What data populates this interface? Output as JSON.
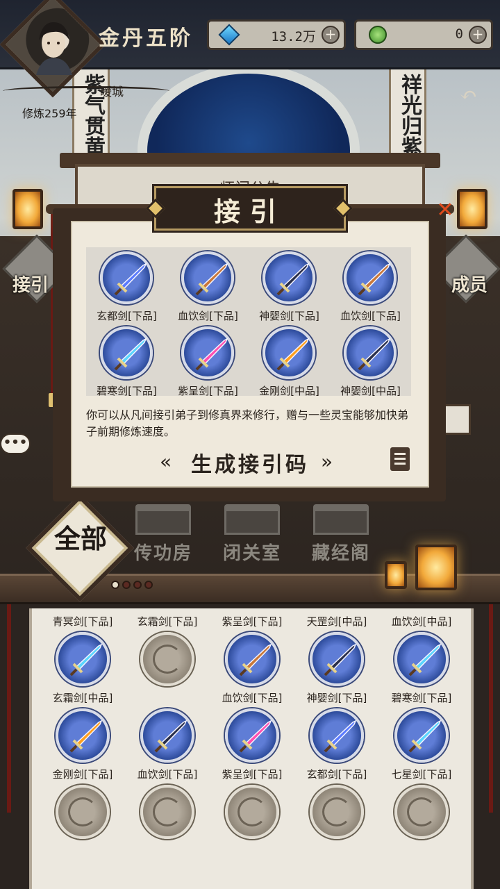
{
  "header": {
    "sect_name": "金丹五阶",
    "resources": [
      {
        "icon": "spirit-stone-icon",
        "value": "13.2万",
        "plus": "+"
      },
      {
        "icon": "jade-icon",
        "value": "0",
        "plus": "+"
      }
    ],
    "city": "暖城",
    "years": "修炼259年"
  },
  "scene": {
    "couplet_left": "紫气贯黄",
    "couplet_right": "祥光归紫",
    "board_title": "师门公告",
    "side_left": "接引",
    "side_right": "成员",
    "chat": "•••",
    "buildings": [
      "传功房",
      "闭关室",
      "藏经阁"
    ],
    "all_tab": "全部"
  },
  "modal": {
    "title": "接引",
    "close": "✕",
    "rewards": [
      {
        "label": "玄都剑[下品]",
        "color": "#5b7bff"
      },
      {
        "label": "血饮剑[下品]",
        "color": "#c9783a"
      },
      {
        "label": "神婴剑[下品]",
        "color": "#2a2f4a"
      },
      {
        "label": "血饮剑[下品]",
        "color": "#c9783a"
      },
      {
        "label": "碧寒剑[下品]",
        "color": "#5ad6ff"
      },
      {
        "label": "紫呈剑[下品]",
        "color": "#ff4fb0"
      },
      {
        "label": "金刚剑[中品]",
        "color": "#ffa01e"
      },
      {
        "label": "神婴剑[中品]",
        "color": "#2a2f4a"
      }
    ],
    "description": "你可以从凡间接引弟子到修真界来修行，赠与一些灵宝能够加快弟子前期修炼速度。",
    "generate_button": "生成接引码",
    "arrow_left": "«",
    "arrow_right": "»"
  },
  "inventory": {
    "items": [
      {
        "label": "青冥剑[下品]",
        "color": "#5ad6ff",
        "empty": false
      },
      {
        "label": "玄霜剑[下品]",
        "color": "",
        "empty": true
      },
      {
        "label": "紫呈剑[下品]",
        "color": "#c9783a",
        "empty": false
      },
      {
        "label": "天罡剑[中品]",
        "color": "#2a2f4a",
        "empty": false
      },
      {
        "label": "血饮剑[中品]",
        "color": "#5ad6ff",
        "empty": false
      },
      {
        "label": "玄霜剑[中品]",
        "color": "#ffa01e",
        "empty": false
      },
      {
        "label": "",
        "color": "#2a2f4a",
        "empty": false
      },
      {
        "label": "血饮剑[下品]",
        "color": "#ff4fb0",
        "empty": false
      },
      {
        "label": "神婴剑[下品]",
        "color": "#5b7bff",
        "empty": false
      },
      {
        "label": "碧寒剑[下品]",
        "color": "#5ad6ff",
        "empty": false
      },
      {
        "label": "金刚剑[下品]",
        "color": "",
        "empty": true
      },
      {
        "label": "血饮剑[下品]",
        "color": "",
        "empty": true
      },
      {
        "label": "紫呈剑[下品]",
        "color": "",
        "empty": true
      },
      {
        "label": "玄都剑[下品]",
        "color": "",
        "empty": true
      },
      {
        "label": "七星剑[下品]",
        "color": "",
        "empty": true
      }
    ]
  },
  "colors": {
    "accent_gold": "#e1c06b",
    "close_red": "#e04a1c",
    "paper": "#efe9dc",
    "frame_dark": "#3a2c22"
  }
}
